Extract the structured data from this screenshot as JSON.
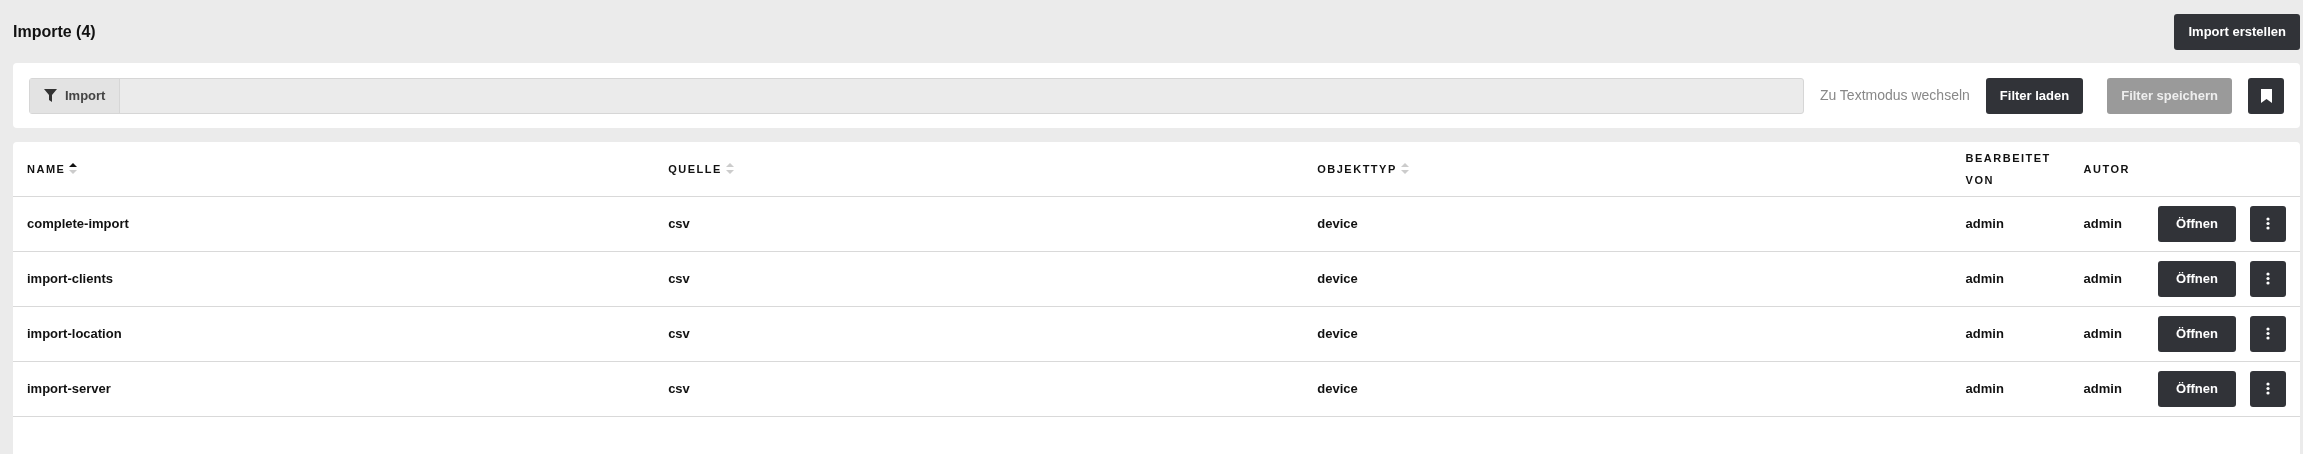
{
  "page_title": "Importe (4)",
  "create_button": "Import erstellen",
  "filter": {
    "chip": "Import",
    "text_mode_link": "Zu Textmodus wechseln",
    "buttons": [
      {
        "label": "Filter laden",
        "disabled": false
      },
      {
        "label": "Filter speichern",
        "disabled": true
      }
    ]
  },
  "table": {
    "columns": [
      {
        "label": "NAME",
        "sorted": true
      },
      {
        "label": "QUELLE",
        "sorted": false
      },
      {
        "label": "OBJEKTTYP",
        "sorted": false
      },
      {
        "label": "BEARBEITET VON"
      },
      {
        "label": "AUTOR"
      }
    ],
    "rows": [
      {
        "cells": [
          "complete-import",
          "csv",
          "device",
          "admin",
          "admin"
        ],
        "open_button": "Öffnen"
      },
      {
        "cells": [
          "import-clients",
          "csv",
          "device",
          "admin",
          "admin"
        ],
        "open_button": "Öffnen"
      },
      {
        "cells": [
          "import-location",
          "csv",
          "device",
          "admin",
          "admin"
        ],
        "open_button": "Öffnen"
      },
      {
        "cells": [
          "import-server",
          "csv",
          "device",
          "admin",
          "admin"
        ],
        "open_button": "Öffnen"
      }
    ]
  }
}
